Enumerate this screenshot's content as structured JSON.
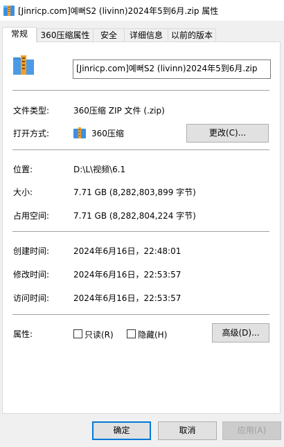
{
  "window": {
    "title": "[Jinricp.com]예뻐S2 (livinn)2024年5到6月.zip 属性"
  },
  "tabs": [
    "常规",
    "360压缩属性",
    "安全",
    "详细信息",
    "以前的版本"
  ],
  "general": {
    "file_name": "[Jinricp.com]예뻐S2 (livinn)2024年5到6月.zip",
    "file_type_label": "文件类型:",
    "file_type_value": "360压缩 ZIP 文件 (.zip)",
    "open_with_label": "打开方式:",
    "open_with_value": "360压缩",
    "change_button": "更改(C)...",
    "location_label": "位置:",
    "location_value": "D:\\L\\视频\\6.1",
    "size_label": "大小:",
    "size_value": "7.71 GB (8,282,803,899 字节)",
    "size_on_disk_label": "占用空间:",
    "size_on_disk_value": "7.71 GB (8,282,804,224 字节)",
    "created_label": "创建时间:",
    "created_value": "2024年6月16日，22:48:01",
    "modified_label": "修改时间:",
    "modified_value": "2024年6月16日，22:53:57",
    "accessed_label": "访问时间:",
    "accessed_value": "2024年6月16日，22:53:57",
    "attributes_label": "属性:",
    "readonly_label": "只读(R)",
    "hidden_label": "隐藏(H)",
    "advanced_button": "高级(D)..."
  },
  "footer": {
    "ok": "确定",
    "cancel": "取消",
    "apply": "应用(A)"
  },
  "colors": {
    "accent": "#0078d7",
    "zip_blue": "#3f8fe0",
    "zip_orange": "#f0a028"
  },
  "icons": [
    "zip-archive-icon"
  ]
}
